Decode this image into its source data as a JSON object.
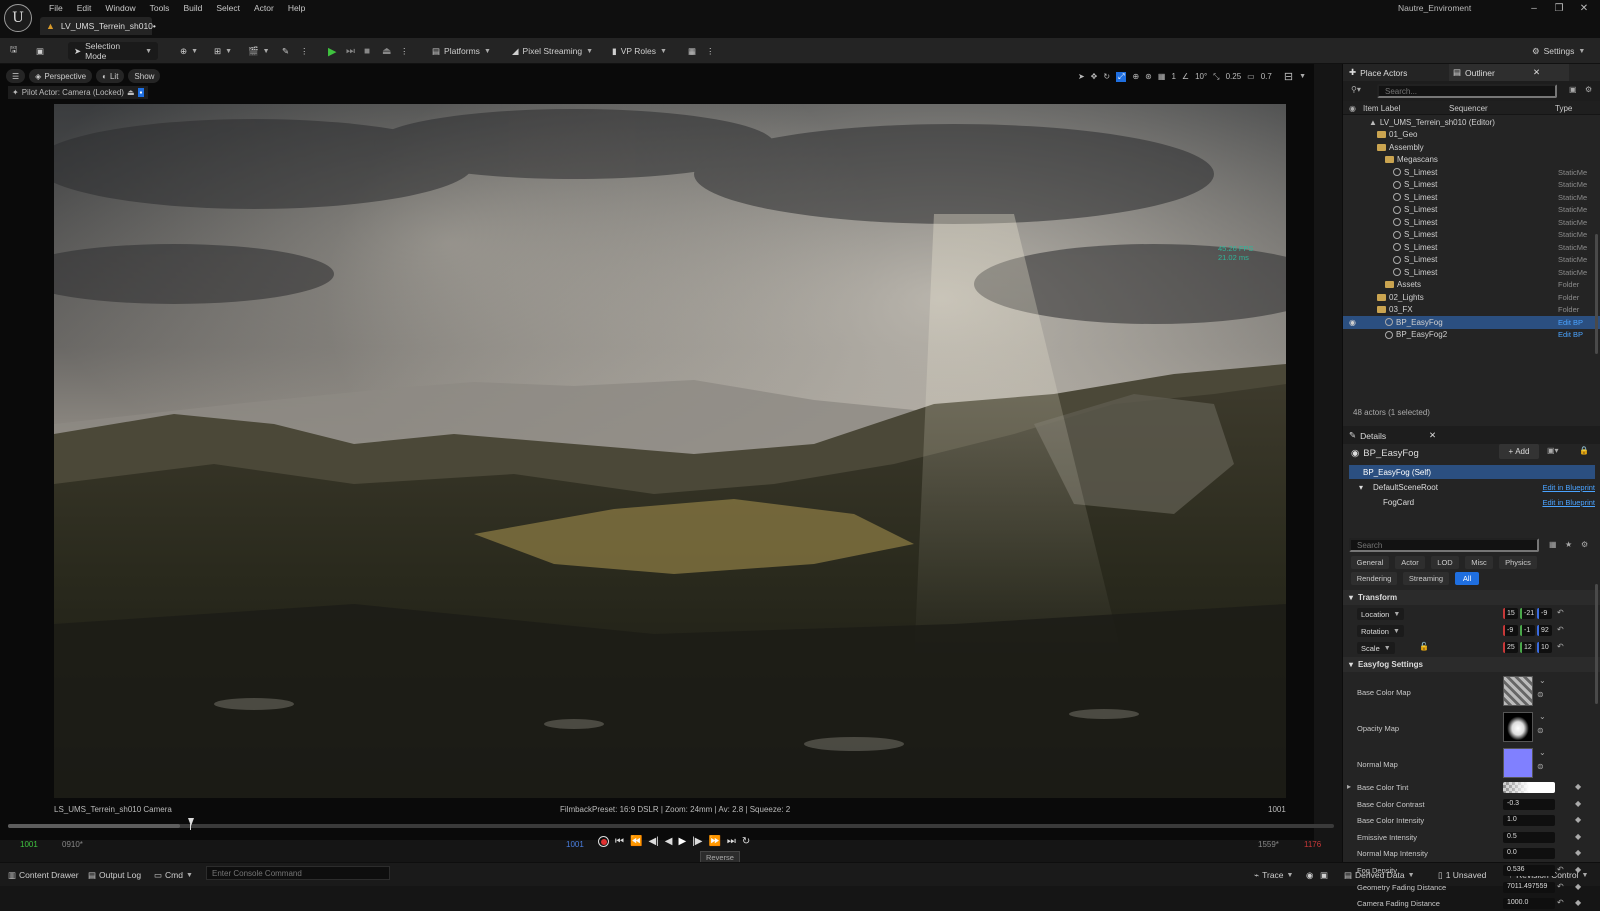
{
  "app": {
    "menu": [
      "File",
      "Edit",
      "Window",
      "Tools",
      "Build",
      "Select",
      "Actor",
      "Help"
    ],
    "project_name": "Nautre_Enviroment",
    "doc_tab": "LV_UMS_Terrein_sh010•"
  },
  "toolbar": {
    "selection_mode": "Selection Mode",
    "platforms": "Platforms",
    "pixel_streaming": "Pixel Streaming",
    "vp_roles": "VP Roles",
    "settings": "Settings"
  },
  "viewport": {
    "perspective": "Perspective",
    "lit": "Lit",
    "show": "Show",
    "pilot": "Pilot Actor: Camera (Locked)",
    "grid_snap": "1",
    "rot_snap": "10°",
    "scale_snap": "0.25",
    "cam_speed": "0.7",
    "fps": "45.26 FPS",
    "ms": "21.02 ms",
    "camera_label": "LS_UMS_Terrein_sh010 Camera",
    "filmback": "FilmbackPreset: 16:9 DSLR | Zoom: 24mm | Av: 2.8 | Squeeze: 2",
    "frame": "1001"
  },
  "sequencer": {
    "start_green": "1001",
    "start_gray": "0910*",
    "current_blue": "1001",
    "end_gray": "1559*",
    "end_red": "1176",
    "tooltip": "Reverse",
    "progress": 0.13
  },
  "statusbar": {
    "content_drawer": "Content Drawer",
    "output_log": "Output Log",
    "cmd": "Cmd",
    "console_placeholder": "Enter Console Command",
    "trace": "Trace",
    "derived_data": "Derived Data",
    "unsaved": "1 Unsaved",
    "revision": "Revision Control"
  },
  "outliner": {
    "place_actors": "Place Actors",
    "title": "Outliner",
    "search_placeholder": "Search...",
    "col_label": "Item Label",
    "col_sequencer": "Sequencer",
    "col_type": "Type",
    "items": [
      {
        "label": "LV_UMS_Terrein_sh010 (Editor)",
        "type": "",
        "indent": 1,
        "icon": "level"
      },
      {
        "label": "01_Geo",
        "type": "",
        "indent": 2,
        "icon": "folder"
      },
      {
        "label": "Assembly",
        "type": "",
        "indent": 2,
        "icon": "folder"
      },
      {
        "label": "Megascans",
        "type": "",
        "indent": 3,
        "icon": "folder"
      },
      {
        "label": "S_Limest",
        "type": "StaticMe",
        "indent": 4,
        "icon": "mesh"
      },
      {
        "label": "S_Limest",
        "type": "StaticMe",
        "indent": 4,
        "icon": "mesh"
      },
      {
        "label": "S_Limest",
        "type": "StaticMe",
        "indent": 4,
        "icon": "mesh"
      },
      {
        "label": "S_Limest",
        "type": "StaticMe",
        "indent": 4,
        "icon": "mesh"
      },
      {
        "label": "S_Limest",
        "type": "StaticMe",
        "indent": 4,
        "icon": "mesh"
      },
      {
        "label": "S_Limest",
        "type": "StaticMe",
        "indent": 4,
        "icon": "mesh"
      },
      {
        "label": "S_Limest",
        "type": "StaticMe",
        "indent": 4,
        "icon": "mesh"
      },
      {
        "label": "S_Limest",
        "type": "StaticMe",
        "indent": 4,
        "icon": "mesh"
      },
      {
        "label": "S_Limest",
        "type": "StaticMe",
        "indent": 4,
        "icon": "mesh"
      },
      {
        "label": "Assets",
        "type": "Folder",
        "indent": 3,
        "icon": "folder"
      },
      {
        "label": "02_Lights",
        "type": "Folder",
        "indent": 2,
        "icon": "folder"
      },
      {
        "label": "03_FX",
        "type": "Folder",
        "indent": 2,
        "icon": "folder"
      },
      {
        "label": "BP_EasyFog",
        "type": "Edit BP",
        "indent": 3,
        "icon": "mesh",
        "selected": true
      },
      {
        "label": "BP_EasyFog2",
        "type": "Edit BP",
        "indent": 3,
        "icon": "mesh"
      }
    ],
    "count": "48 actors (1 selected)"
  },
  "details": {
    "title": "Details",
    "object": "BP_EasyFog",
    "add": "Add",
    "self": "BP_EasyFog (Self)",
    "components": [
      {
        "name": "DefaultSceneRoot",
        "edit": "Edit in Blueprint"
      },
      {
        "name": "FogCard",
        "edit": "Edit in Blueprint"
      }
    ],
    "search_placeholder": "Search",
    "filters_row1": [
      "General",
      "Actor",
      "LOD",
      "Misc",
      "Physics"
    ],
    "filters_row2": [
      "Rendering",
      "Streaming",
      "All"
    ],
    "transform": "Transform",
    "location": {
      "label": "Location",
      "x": "15",
      "y": "-21",
      "z": "-9"
    },
    "rotation": {
      "label": "Rotation",
      "x": "-9",
      "y": "-1",
      "z": "92"
    },
    "scale": {
      "label": "Scale",
      "x": "25",
      "y": "12",
      "z": "10"
    },
    "easyfog": "Easyfog Settings",
    "base_color_map": "Base Color Map",
    "opacity_map": "Opacity Map",
    "normal_map": "Normal Map",
    "props": [
      {
        "label": "Base Color Tint",
        "value": ""
      },
      {
        "label": "Base Color Contrast",
        "value": "-0.3"
      },
      {
        "label": "Base Color Intensity",
        "value": "1.0"
      },
      {
        "label": "Emissive Intensity",
        "value": "0.5"
      },
      {
        "label": "Normal Map Intensity",
        "value": "0.0"
      },
      {
        "label": "Fog Density",
        "value": "0.536"
      },
      {
        "label": "Geometry Fading Distance",
        "value": "7011.497559"
      },
      {
        "label": "Camera Fading Distance",
        "value": "1000.0"
      }
    ]
  },
  "colors": {
    "accent": "#1f6fe0",
    "selection": "#2b4f80",
    "link": "#4aa3ff",
    "fps": "#2fb59a",
    "record": "#e03030"
  }
}
